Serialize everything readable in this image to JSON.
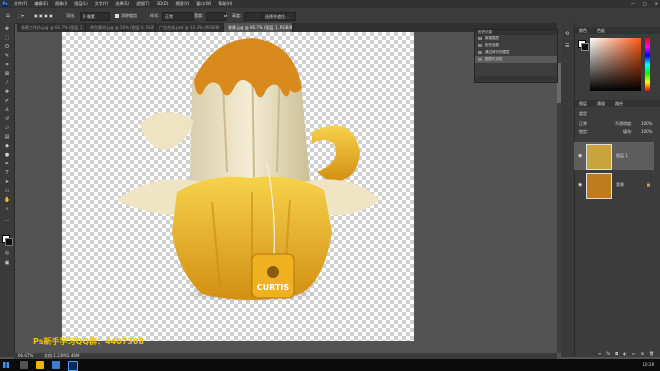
{
  "app": {
    "logo": "Ps"
  },
  "menubar": {
    "items": [
      "文件(F)",
      "编辑(E)",
      "图像(I)",
      "图层(L)",
      "文字(Y)",
      "选择(S)",
      "滤镜(T)",
      "3D(D)",
      "视图(V)",
      "窗口(W)",
      "帮助(H)"
    ],
    "window_controls": [
      "—",
      "□",
      "✕"
    ]
  },
  "options": {
    "feather_label": "羽化:",
    "feather_value": "0 像素",
    "antialias_label": "消除锯齿",
    "style_label": "样式:",
    "style_value": "正常",
    "width_label": "宽度:",
    "height_label": "高度:",
    "select_mask_button": "选择并遮住..."
  },
  "tabs": [
    {
      "label": "香蕉工作坊.jpg @ 66.7% (图层 1, RGB/8#)",
      "active": false
    },
    {
      "label": "茶包素材.jpg @ 50% (图层 0, RGB/8#)",
      "active": false
    },
    {
      "label": "广告合成.psd @ 33.3% (RGB/8)",
      "active": false
    },
    {
      "label": "香蕉.jpg @ 66.7% (图层 1, RGB/8#)",
      "active": true
    }
  ],
  "status": {
    "zoom": "66.67%",
    "doc": "文档:1.23M/2.46M"
  },
  "overlay_text": "Ps新手学习QQ群：4407308",
  "history": {
    "title": "历史记录",
    "rows": [
      {
        "label": "新建图层",
        "active": false
      },
      {
        "label": "矩形选框",
        "active": false
      },
      {
        "label": "通过拷贝的图层",
        "active": false
      },
      {
        "label": "图层可见性",
        "active": true
      }
    ]
  },
  "right_panels": {
    "color_tabs": [
      "颜色",
      "色板"
    ],
    "layers_tabs": [
      "图层",
      "通道",
      "路径"
    ],
    "kind_label": "类型",
    "blend_mode": "正常",
    "opacity_label": "不透明度:",
    "opacity_value": "100%",
    "lock_label": "锁定:",
    "fill_label": "填充:",
    "fill_value": "100%"
  },
  "layers": [
    {
      "name": "图层 1",
      "active": true,
      "thumb_color": "#c9a43a"
    },
    {
      "name": "背景",
      "active": false,
      "thumb_color": "#c07b1c"
    }
  ],
  "colors": {
    "accent": "#f2c400",
    "foreground": "#ffffff",
    "background": "#111111"
  },
  "taskbar": {
    "time": "10:28"
  }
}
